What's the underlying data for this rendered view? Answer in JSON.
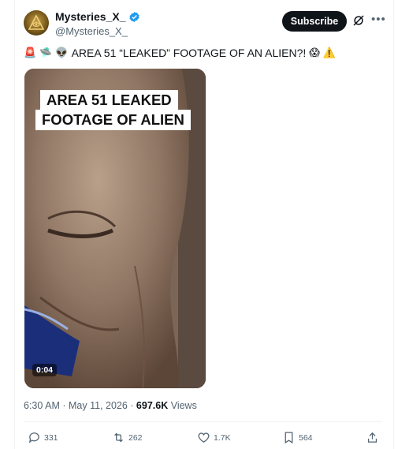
{
  "author": {
    "name": "Mysteries_X_",
    "handle": "@Mysteries_X_",
    "verified": true
  },
  "header": {
    "subscribe_label": "Subscribe"
  },
  "tweet": {
    "emoji_prefix": [
      "🚨",
      "🛸",
      "👽"
    ],
    "text": "AREA 51 “LEAKED” FOOTAGE OF AN ALIEN?!",
    "emoji_suffix": [
      "😱",
      "⚠️"
    ]
  },
  "media": {
    "caption_line1": "AREA 51 LEAKED",
    "caption_line2": "FOOTAGE OF ALIEN",
    "duration": "0:04"
  },
  "meta": {
    "time": "6:30 AM",
    "separator": " · ",
    "date": "May 11, 2026",
    "views_count": "697.6K",
    "views_label": "Views"
  },
  "actions": {
    "replies": "331",
    "reposts": "262",
    "likes": "1.7K",
    "bookmarks": "564"
  },
  "colors": {
    "text": "#0f1419",
    "secondary": "#536471",
    "verified": "#1d9bf0",
    "button": "#0f1419"
  }
}
